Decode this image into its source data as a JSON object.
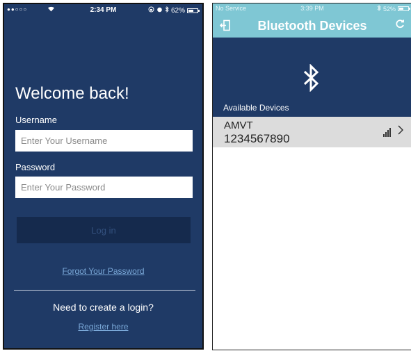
{
  "login_screen": {
    "status_bar": {
      "signal": "●●○○○",
      "time": "2:34 PM",
      "battery": "62%",
      "battery_fill": 0.62
    },
    "title": "Welcome back!",
    "username_label": "Username",
    "username_placeholder": "Enter Your Username",
    "password_label": "Password",
    "password_placeholder": "Enter Your Password",
    "login_button": "Log in",
    "forgot_link": "Forgot Your Password",
    "create_prompt": "Need to create a login?",
    "register_link": "Register here"
  },
  "bluetooth_screen": {
    "status_bar": {
      "carrier": "No Service",
      "time": "3:39 PM",
      "battery": "52%",
      "battery_fill": 0.52
    },
    "title": "Bluetooth Devices",
    "section_label": "Available Devices",
    "devices": [
      {
        "name": "AMVT",
        "id": "1234567890",
        "signal_bars": 4
      }
    ]
  },
  "colors": {
    "navy": "#1f3a66",
    "teal": "#7fc7d4",
    "link": "#7aa8d8",
    "row_bg": "#dcdcdc"
  }
}
